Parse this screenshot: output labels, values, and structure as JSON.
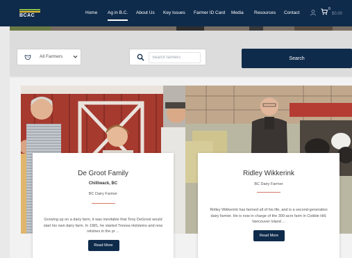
{
  "nav": {
    "logo_text": "BCAC",
    "items": [
      {
        "label": "Home"
      },
      {
        "label": "Ag in B.C."
      },
      {
        "label": "About Us"
      },
      {
        "label": "Key Issues"
      },
      {
        "label": "Farmer ID Card"
      },
      {
        "label": "Media"
      },
      {
        "label": "Resources"
      },
      {
        "label": "Contact"
      }
    ],
    "cart_count": "0",
    "cart_total": "$0.00"
  },
  "filters": {
    "select_value": "All Farmers",
    "search_placeholder": "Search farmers",
    "search_button": "Search"
  },
  "cards": [
    {
      "name": "De Groot Family",
      "location": "Chilliwack, BC",
      "role": "BC Dairy Farmer",
      "description": "Growing up on a dairy farm, it was inevitable that Tony DeGroot would start his own dairy farm. In 1981, he started Tonesa Holsteins and now relishes in the pr ...",
      "button": "Read More"
    },
    {
      "name": "Ridley Wikkerink",
      "location": "",
      "role": "BC Dairy Farmer",
      "description": "Ridley Wikkerink has farmed all of his life, and is a second-generation dairy farmer. He is now in charge of the 300-acre farm in Cobble Hill, Vancouver Island ...",
      "button": "Read More"
    }
  ],
  "colors": {
    "navy": "#0f2b4b",
    "accent": "#d47a68"
  }
}
